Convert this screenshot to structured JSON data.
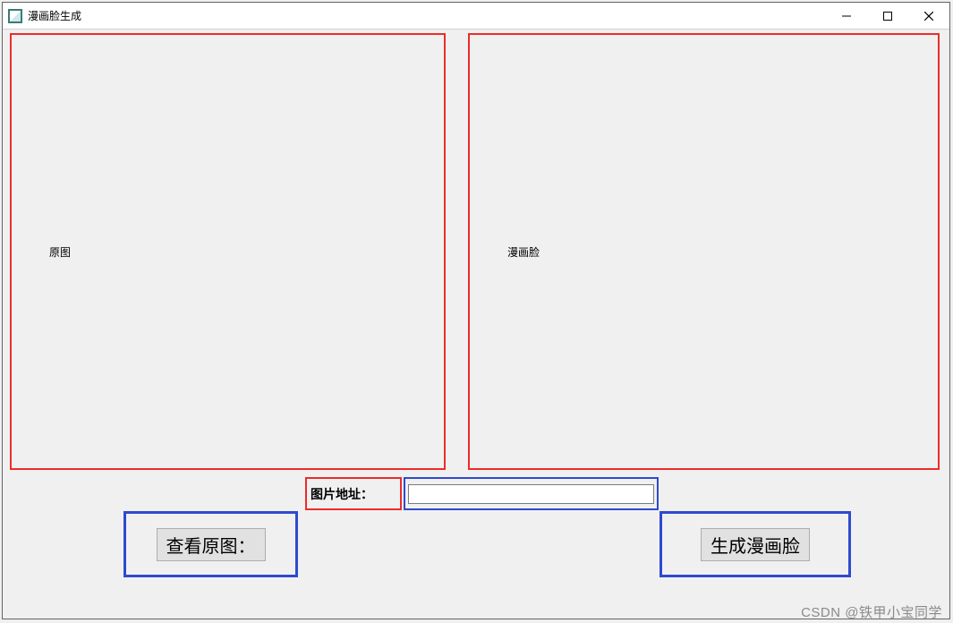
{
  "window": {
    "title": "漫画脸生成"
  },
  "panels": {
    "original_label": "原图",
    "result_label": "漫画脸"
  },
  "address": {
    "label": "图片地址：",
    "value": ""
  },
  "buttons": {
    "view_original": "查看原图：",
    "generate": "生成漫画脸"
  },
  "watermark": "CSDN @铁甲小宝同学"
}
